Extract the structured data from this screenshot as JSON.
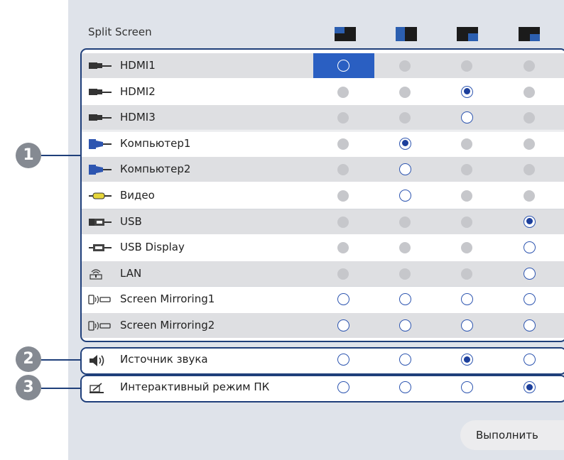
{
  "header": {
    "title": "Split Screen"
  },
  "layout_options": [
    {
      "icon": "layout-top-left-icon"
    },
    {
      "icon": "layout-left-icon"
    },
    {
      "icon": "layout-right-icon"
    },
    {
      "icon": "layout-bottom-right-icon"
    }
  ],
  "sources": [
    {
      "label": "HDMI1",
      "icon": "hdmi-icon",
      "states": [
        "focus",
        "disabled",
        "disabled",
        "disabled"
      ]
    },
    {
      "label": "HDMI2",
      "icon": "hdmi-icon",
      "states": [
        "disabled",
        "disabled",
        "selected",
        "disabled"
      ]
    },
    {
      "label": "HDMI3",
      "icon": "hdmi-icon",
      "states": [
        "disabled",
        "disabled",
        "empty",
        "disabled"
      ]
    },
    {
      "label": "Компьютер1",
      "icon": "computer-icon",
      "states": [
        "disabled",
        "selected",
        "disabled",
        "disabled"
      ]
    },
    {
      "label": "Компьютер2",
      "icon": "computer-icon",
      "states": [
        "disabled",
        "empty",
        "disabled",
        "disabled"
      ]
    },
    {
      "label": "Видео",
      "icon": "video-icon",
      "states": [
        "disabled",
        "empty",
        "disabled",
        "disabled"
      ]
    },
    {
      "label": "USB",
      "icon": "usb-icon",
      "states": [
        "disabled",
        "disabled",
        "disabled",
        "selected"
      ]
    },
    {
      "label": "USB Display",
      "icon": "usb-display-icon",
      "states": [
        "disabled",
        "disabled",
        "disabled",
        "empty"
      ]
    },
    {
      "label": "LAN",
      "icon": "lan-icon",
      "states": [
        "disabled",
        "disabled",
        "disabled",
        "empty"
      ]
    },
    {
      "label": "Screen Mirroring1",
      "icon": "screen-mirroring-icon",
      "states": [
        "empty",
        "empty",
        "empty",
        "empty"
      ]
    },
    {
      "label": "Screen Mirroring2",
      "icon": "screen-mirroring-icon",
      "states": [
        "empty",
        "empty",
        "empty",
        "empty"
      ]
    }
  ],
  "audio": {
    "label": "Источник звука",
    "icon": "speaker-icon",
    "states": [
      "empty",
      "empty",
      "selected",
      "empty"
    ]
  },
  "interactive": {
    "label": "Интерактивный режим ПК",
    "icon": "pen-icon",
    "states": [
      "empty",
      "empty",
      "empty",
      "selected"
    ]
  },
  "callouts": [
    "1",
    "2",
    "3"
  ],
  "execute_button": "Выполнить",
  "colors": {
    "accent": "#2a5fc2",
    "frame": "#1f3f7a",
    "selected_dot": "#1c3f9c",
    "callout": "#858a92"
  }
}
